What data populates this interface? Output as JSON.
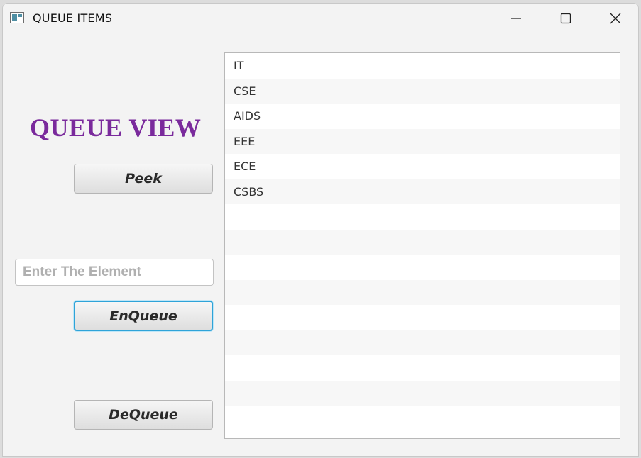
{
  "window": {
    "title": "QUEUE ITEMS",
    "icon": "app-window-icon",
    "controls": {
      "minimize_icon": "minimize-icon",
      "maximize_icon": "maximize-icon",
      "close_icon": "close-icon"
    }
  },
  "main": {
    "heading": "QUEUE VIEW",
    "heading_color": "#7a2a9c",
    "peek_label": "Peek",
    "input": {
      "value": "",
      "placeholder": "Enter The Element"
    },
    "enqueue_label": "EnQueue",
    "dequeue_label": "DeQueue",
    "focus_color": "#2ea3d8"
  },
  "queue": {
    "items": [
      "IT",
      "CSE",
      "AIDS",
      "EEE",
      "ECE",
      "CSBS"
    ],
    "empty_rows": 9
  }
}
